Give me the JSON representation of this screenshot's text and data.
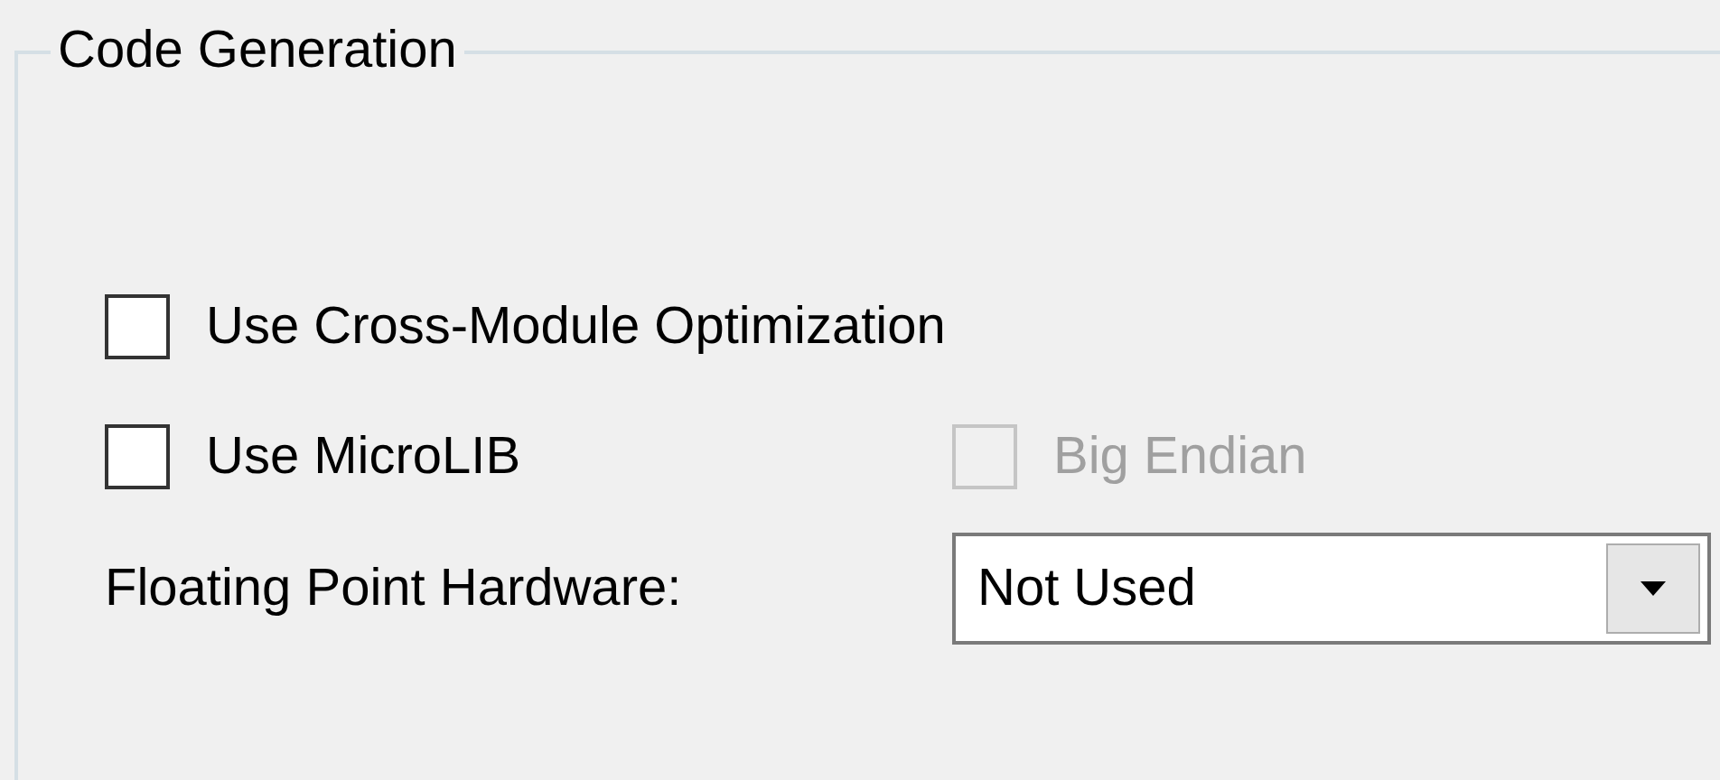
{
  "group": {
    "title": "Code Generation"
  },
  "rows": [
    {
      "items": [
        {
          "kind": "checkbox",
          "label": "Use Cross-Module Optimization",
          "checked": false,
          "disabled": false
        }
      ]
    },
    {
      "items": [
        {
          "kind": "checkbox",
          "label": "Use MicroLIB",
          "checked": false,
          "disabled": false
        },
        {
          "kind": "checkbox",
          "label": "Big Endian",
          "checked": false,
          "disabled": true
        }
      ]
    },
    {
      "items": [
        {
          "kind": "label",
          "label": "Floating Point Hardware:"
        },
        {
          "kind": "select",
          "value": "Not Used"
        }
      ]
    }
  ]
}
